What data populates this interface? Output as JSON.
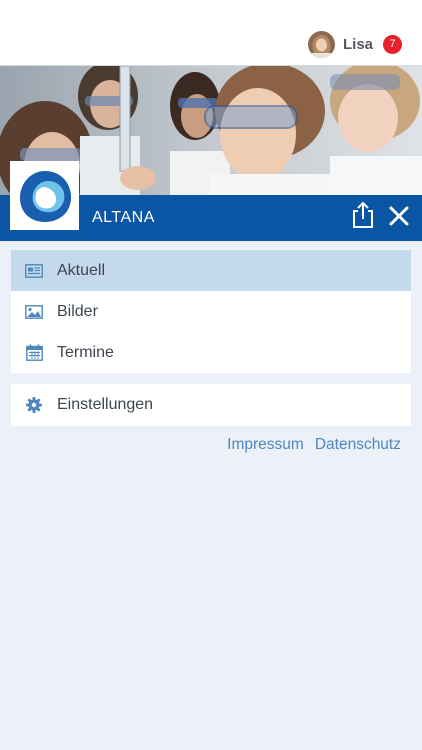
{
  "user": {
    "name": "Lisa",
    "notification_count": "7"
  },
  "header": {
    "brand": "ALTANA"
  },
  "menu": {
    "items": [
      {
        "label": "Aktuell",
        "icon": "newspaper-icon",
        "active": true
      },
      {
        "label": "Bilder",
        "icon": "image-icon",
        "active": false
      },
      {
        "label": "Termine",
        "icon": "calendar-icon",
        "active": false
      }
    ],
    "settings": {
      "label": "Einstellungen",
      "icon": "gear-icon"
    }
  },
  "footer": {
    "impressum": "Impressum",
    "datenschutz": "Datenschutz"
  },
  "colors": {
    "brand_blue": "#0a56a5",
    "active_item": "#c5d9ec",
    "background": "#ecf1f9",
    "badge": "#e8202a",
    "link": "#4f87bd"
  }
}
